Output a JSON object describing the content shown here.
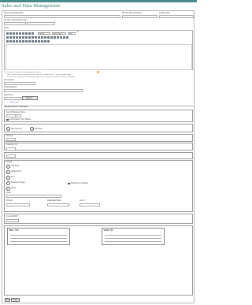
{
  "header": {
    "title": "Sales and Data Management"
  },
  "form": {
    "name_label": "Name and Address/Zip",
    "phone_label": "Primary Phone Number",
    "contact_label": "Contact date",
    "previous_label": "Previous Address/Zip Code",
    "notes_label": "Notes",
    "format_select": "Format",
    "font_select": "Font Family",
    "size_select": "Size",
    "color_label": "A",
    "note_line1": "This text offers support for following tips or formats:",
    "note_line2": "Sign in with a secure pointer text to the editor (Ex., double-click) — select multiple words",
    "note_line3": "if no browser toolbar, the formatting bar options with selected text and press Enter to add links",
    "fax_label": "Fax Number",
    "email_label": "E-Mail Address",
    "attachment_label": "Attachment",
    "browse_label": "Browse...",
    "attach_hint": "Add an Item",
    "section_label": "Self-Employment Information",
    "business_label": "Select Business Name",
    "business_radio_hint": "Business Name",
    "confirm_label": "Confirmation (Yes/ Wants)",
    "opt_new": "New account",
    "opt_renewal": "Renewal",
    "amount_label": "Amount",
    "customer_label": "Customer ID",
    "status_label": "Activity",
    "status_options": [
      "Call Back",
      "Mailed Stuff",
      "Free",
      "Pending Change",
      "Active"
    ],
    "status_side": "Referrals to a Partner",
    "extra_label": "Notes",
    "product_label": "Product",
    "date_label": "Date/Sales Date",
    "rate_label": "Item #",
    "section2_label": "Interest INFO*",
    "sig1_label": "BILL TO:",
    "sig2_label": "SHIP TO:",
    "save_label": "Save",
    "submit_label": "Submit"
  }
}
